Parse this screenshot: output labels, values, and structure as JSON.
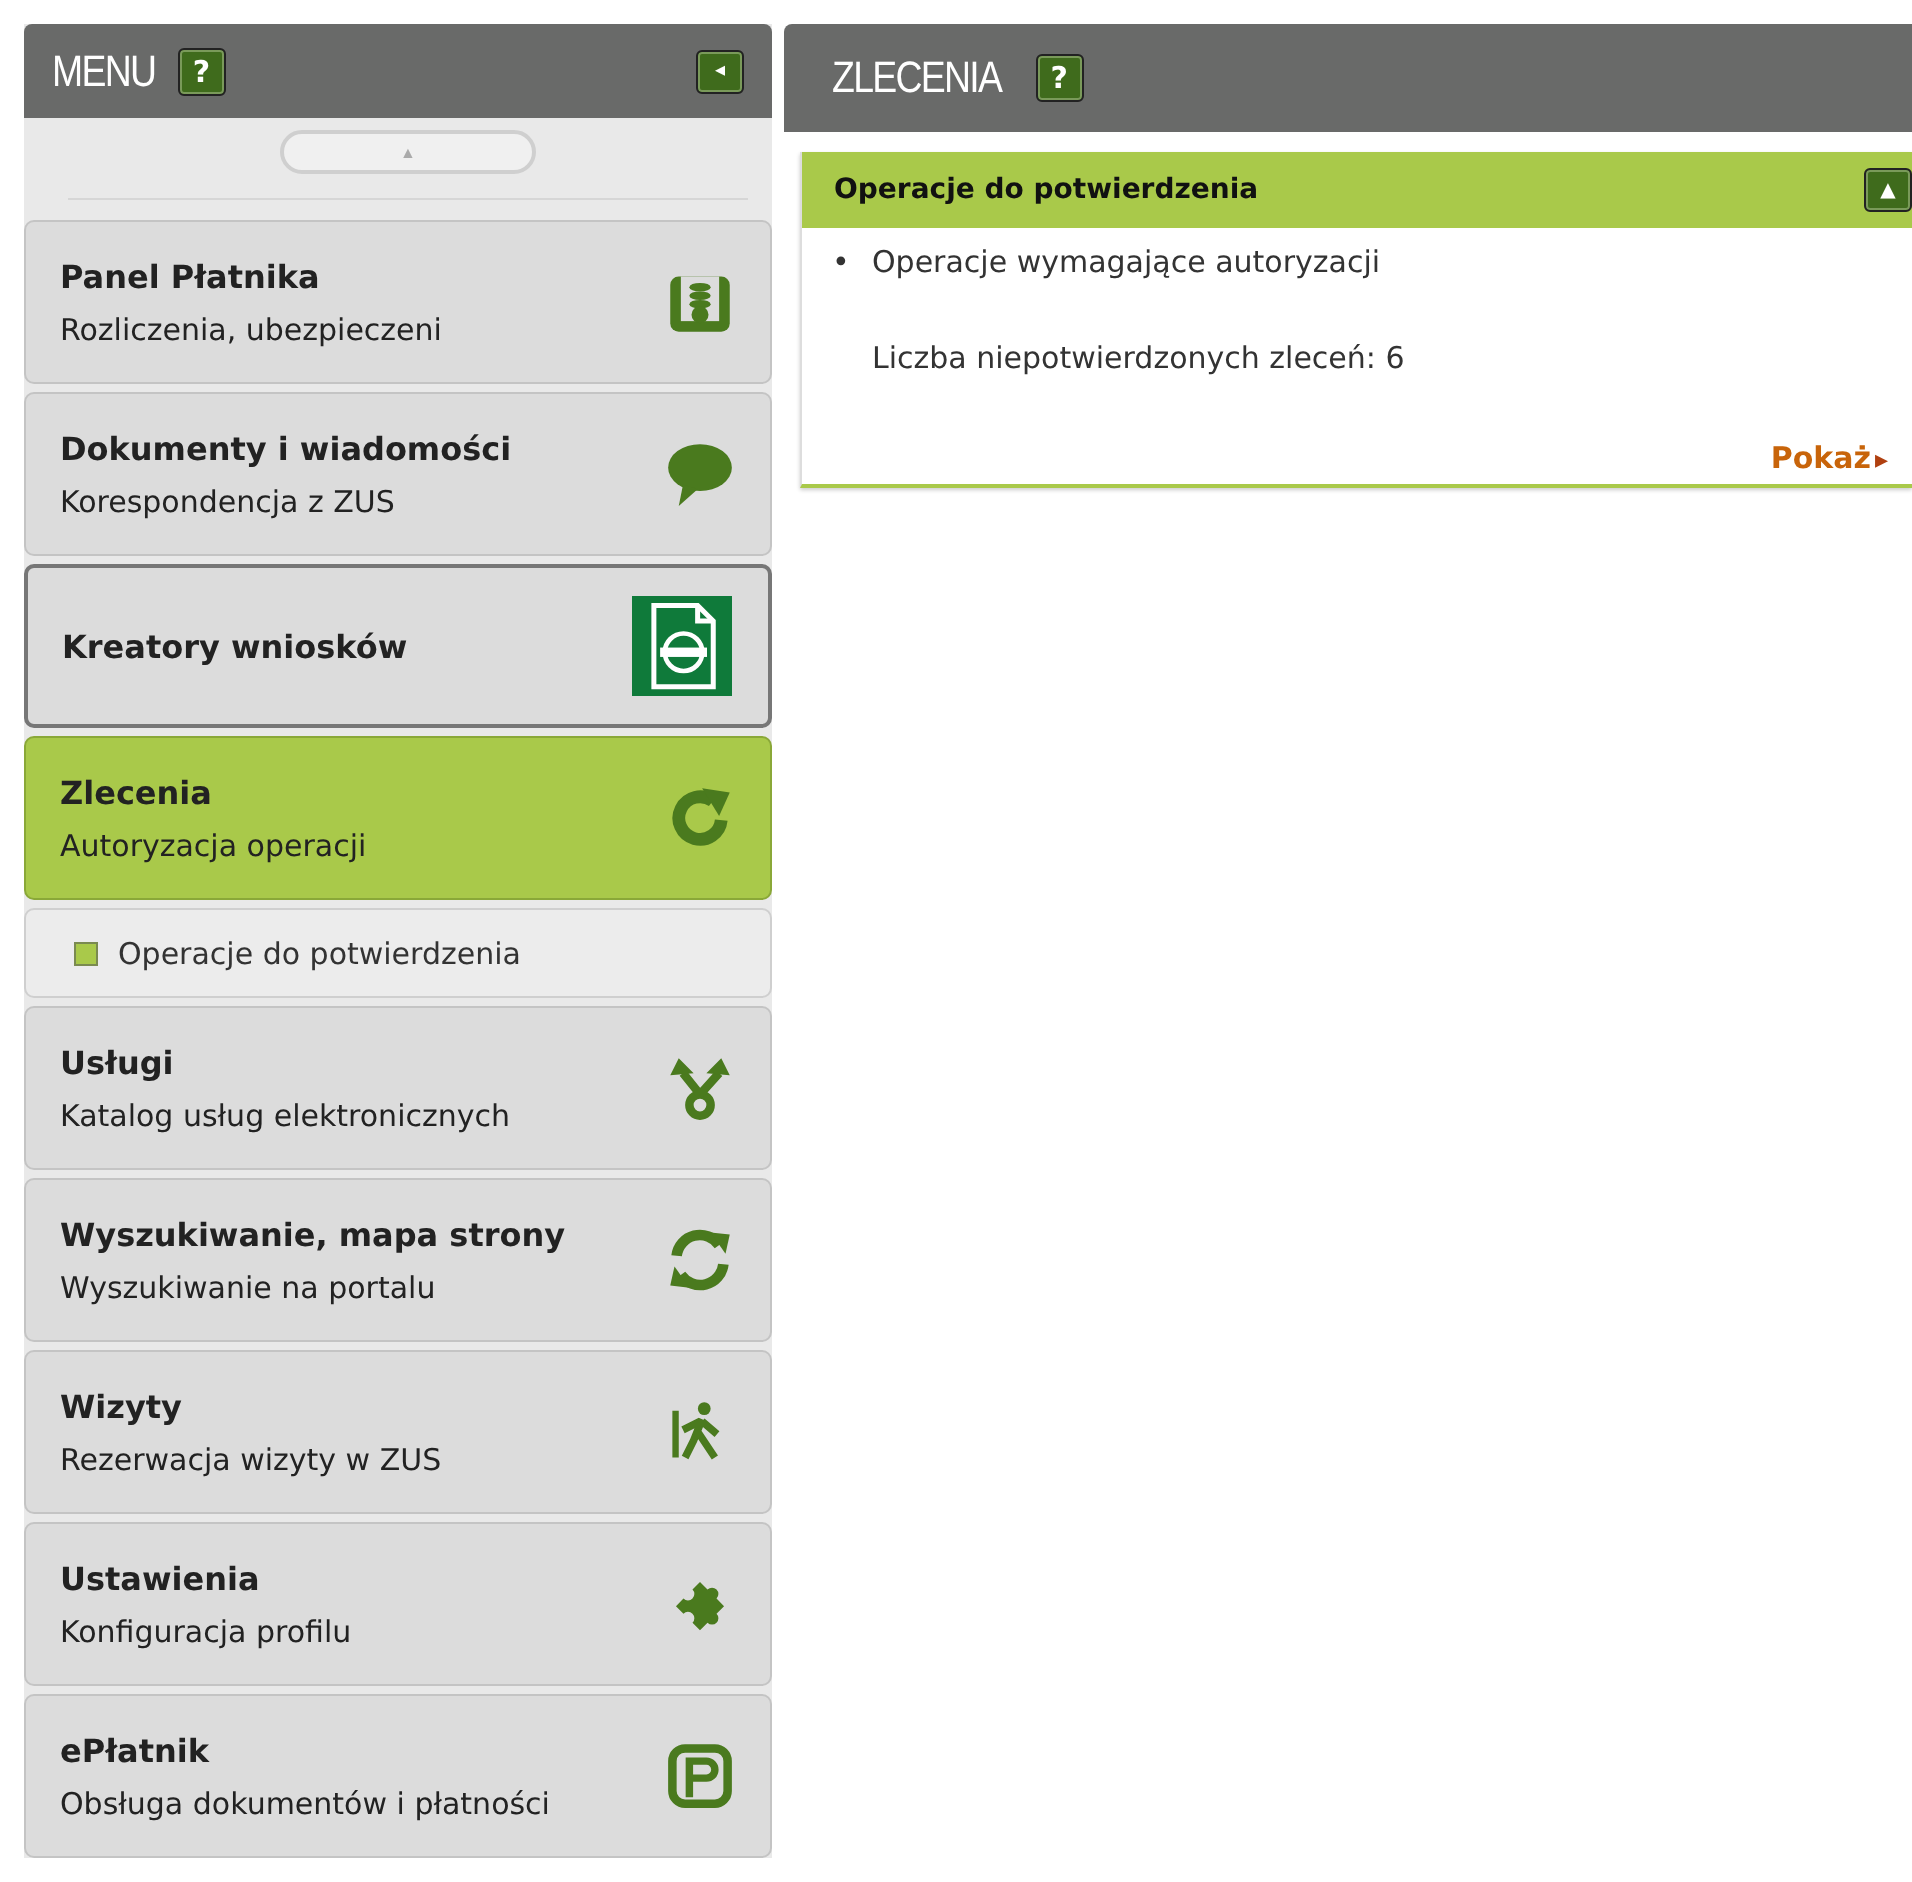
{
  "menu": {
    "title": "MENU",
    "help": "?",
    "collapse_button": "◂",
    "scroll_up": "▲",
    "items": [
      {
        "title": "Panel Płatnika",
        "subtitle": "Rozliczenia, ubezpieczeni",
        "selected": false,
        "focused": false
      },
      {
        "title": "Dokumenty i wiadomości",
        "subtitle": "Korespondencja z ZUS",
        "selected": false,
        "focused": false
      },
      {
        "title": "Kreatory wniosków",
        "selected": false,
        "focused": true
      },
      {
        "title": "Zlecenia",
        "subtitle": "Autoryzacja operacji",
        "selected": true,
        "focused": false,
        "children": [
          {
            "label": "Operacje do potwierdzenia"
          }
        ]
      },
      {
        "title": "Usługi",
        "subtitle": "Katalog usług elektronicznych",
        "selected": false,
        "focused": false
      },
      {
        "title": "Wyszukiwanie, mapa strony",
        "subtitle": "Wyszukiwanie na portalu",
        "selected": false,
        "focused": false
      },
      {
        "title": "Wizyty",
        "subtitle": "Rezerwacja wizyty w ZUS",
        "selected": false,
        "focused": false
      },
      {
        "title": "Ustawienia",
        "subtitle": "Konfiguracja profilu",
        "selected": false,
        "focused": false
      },
      {
        "title": "ePłatnik",
        "subtitle": "Obsługa dokumentów i płatności",
        "selected": false,
        "focused": false
      }
    ]
  },
  "main": {
    "title": "ZLECENIA",
    "help": "?",
    "panels": [
      {
        "title": "Operacje do potwierdzenia",
        "expanded": true,
        "toggle": "▲",
        "bullets": [
          {
            "marker": "•",
            "text": "Operacje wymagające autoryzacji"
          }
        ],
        "count_text": "Liczba niepotwierdzonych zleceń: 6",
        "link": "Pokaż",
        "link_arrow": "▸"
      }
    ]
  }
}
